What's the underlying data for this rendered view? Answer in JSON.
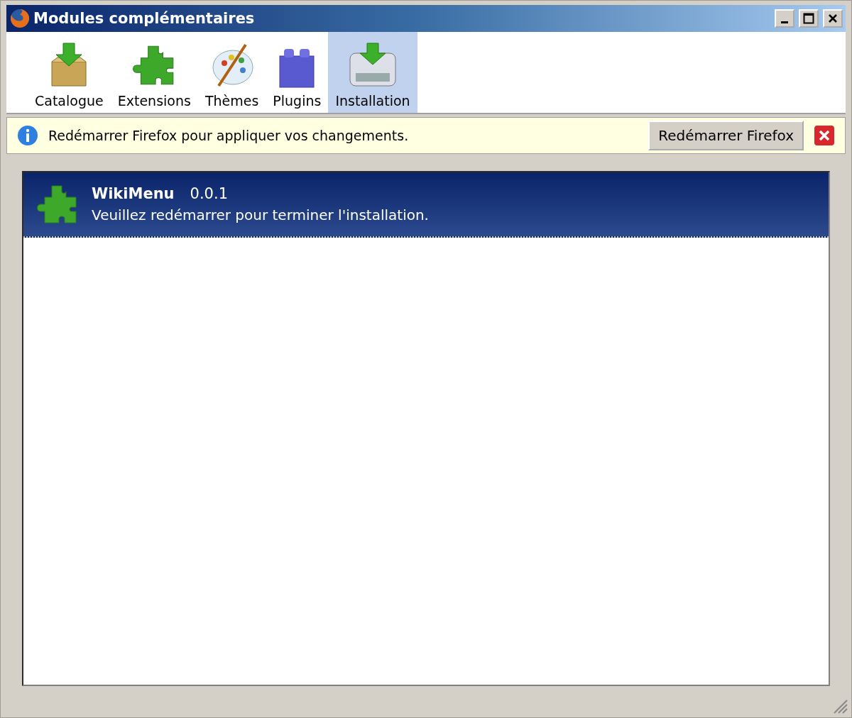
{
  "window": {
    "title": "Modules complémentaires"
  },
  "tabs": [
    {
      "label": "Catalogue",
      "kind": "catalog",
      "selected": false
    },
    {
      "label": "Extensions",
      "kind": "extensions",
      "selected": false
    },
    {
      "label": "Thèmes",
      "kind": "themes",
      "selected": false
    },
    {
      "label": "Plugins",
      "kind": "plugins",
      "selected": false
    },
    {
      "label": "Installation",
      "kind": "install",
      "selected": true
    }
  ],
  "notification": {
    "message": "Redémarrer Firefox pour appliquer vos changements.",
    "button": "Redémarrer Firefox"
  },
  "addons": [
    {
      "name": "WikiMenu",
      "version": "0.0.1",
      "status": "Veuillez redémarrer pour terminer l'installation.",
      "selected": true
    }
  ]
}
